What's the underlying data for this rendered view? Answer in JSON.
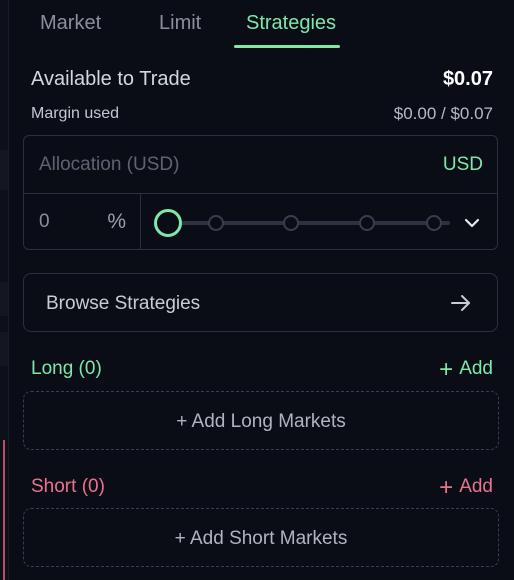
{
  "tabs": [
    {
      "label": "Market",
      "active": false
    },
    {
      "label": "Limit",
      "active": false
    },
    {
      "label": "Strategies",
      "active": true
    }
  ],
  "account": {
    "available_label": "Available to Trade",
    "available_value": "$0.07",
    "margin_label": "Margin used",
    "margin_value": "$0.00 / $0.07"
  },
  "allocation": {
    "placeholder": "Allocation (USD)",
    "unit": "USD",
    "percent_value": "0",
    "percent_sign": "%",
    "slider_value_percent": 0
  },
  "browse": {
    "label": "Browse Strategies"
  },
  "long": {
    "label": "Long (0)",
    "add_plus": "+",
    "add_label": "Add",
    "add_markets_label": "+ Add Long Markets"
  },
  "short": {
    "label": "Short (0)",
    "add_plus": "+",
    "add_label": "Add",
    "add_markets_label": "+ Add Short Markets"
  },
  "colors": {
    "accent_green": "#7ee8a8",
    "accent_red": "#e8738d",
    "background": "#0b0d16",
    "border": "#2c303d"
  },
  "icons": {
    "chevron": "chevron-down-icon",
    "arrow": "arrow-right-icon"
  }
}
